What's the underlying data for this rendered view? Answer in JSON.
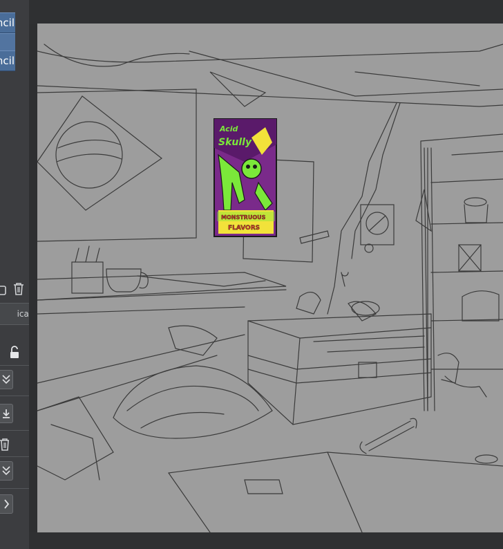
{
  "layers_panel": {
    "layer_1_label": "ncil",
    "layer_2_label": "ncil",
    "blend_mode_value": "ical pe"
  },
  "icons": {
    "lock": "lock-icon",
    "trash": "trash-icon",
    "check": "check-icon",
    "download": "download-icon",
    "chevron": "chevron-right-icon",
    "padlock": "padlock-open-icon"
  },
  "poster": {
    "line1": "Acid",
    "line2": "Skully",
    "line3": "MONSTRUOUS",
    "line4": "FLAVORS"
  },
  "colors": {
    "canvas": "#9d9d9d",
    "panel": "#3c3d40",
    "layer_selected": "#4a6d99",
    "poster_purple": "#7a2a8a",
    "poster_green": "#7be83a",
    "poster_yellow": "#f2e23a",
    "poster_red": "#e23a2a"
  }
}
